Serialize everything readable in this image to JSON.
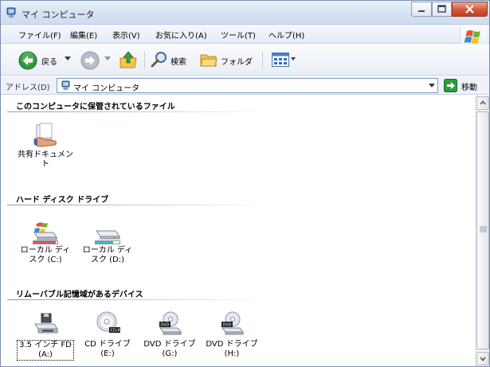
{
  "window": {
    "title": "マイ コンピュータ"
  },
  "menu": [
    "ファイル(F)",
    "編集(E)",
    "表示(V)",
    "お気に入り(A)",
    "ツール(T)",
    "ヘルプ(H)"
  ],
  "toolbar": {
    "back_label": "戻る",
    "search_label": "検索",
    "folders_label": "フォルダ"
  },
  "address": {
    "label": "アドレス(D)",
    "value": "マイ コンピュータ",
    "go_label": "移動"
  },
  "groups": [
    {
      "title": "このコンピュータに保管されているファイル",
      "items": [
        {
          "label": "共有ドキュメント",
          "icon": "shared-documents-icon"
        }
      ]
    },
    {
      "title": "ハード ディスク ドライブ",
      "items": [
        {
          "label": "ローカル ディスク (C:)",
          "icon": "system-disk-icon",
          "bar_color": "#d9534f"
        },
        {
          "label": "ローカル ディスク (D:)",
          "icon": "disk-icon",
          "bar_color": "#3fb3c4"
        }
      ]
    },
    {
      "title": "リムーバブル記憶域があるデバイス",
      "items": [
        {
          "label": "3.5 インチ FD (A:)",
          "icon": "floppy-icon"
        },
        {
          "label": "CD ドライブ (E:)",
          "icon": "cd-drive-icon",
          "badge": "CD-R"
        },
        {
          "label": "DVD ドライブ (G:)",
          "icon": "dvd-drive-icon",
          "badge": "DVD"
        },
        {
          "label": "DVD ドライブ (H:)",
          "icon": "dvd-drive-icon",
          "badge": "DVD"
        }
      ]
    }
  ]
}
